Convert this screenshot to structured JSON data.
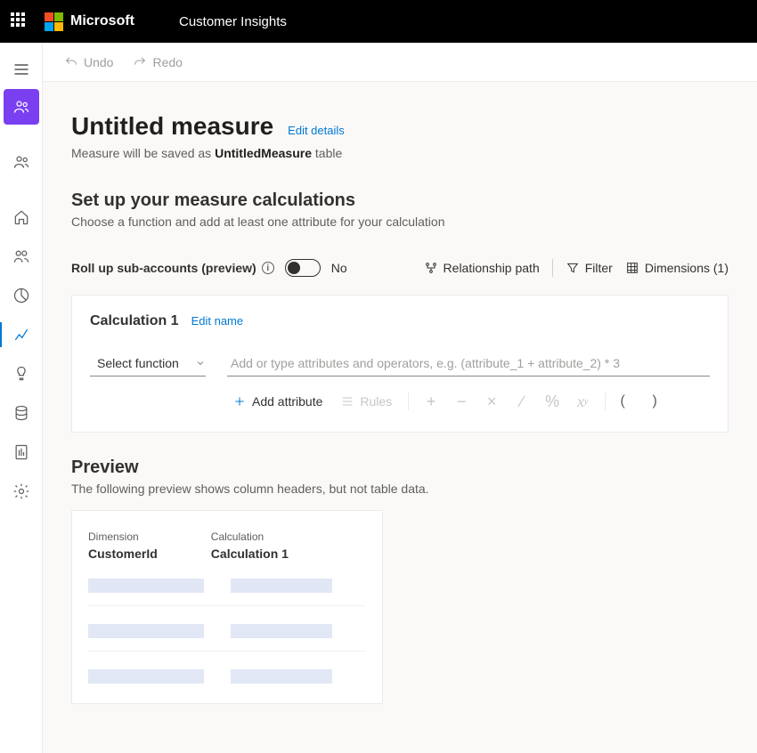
{
  "header": {
    "brand": "Microsoft",
    "product": "Customer Insights"
  },
  "commands": {
    "undo": "Undo",
    "redo": "Redo"
  },
  "page": {
    "title": "Untitled measure",
    "edit_details": "Edit details",
    "save_prefix": "Measure will be saved as ",
    "save_name": "UntitledMeasure",
    "save_suffix": " table"
  },
  "section": {
    "title": "Set up your measure calculations",
    "desc": "Choose a function and add at least one attribute for your calculation"
  },
  "rollup": {
    "label": "Roll up sub-accounts (preview)",
    "state": "No"
  },
  "tools": {
    "relationship": "Relationship path",
    "filter": "Filter",
    "dimensions": "Dimensions (1)"
  },
  "calc": {
    "title": "Calculation 1",
    "edit_name": "Edit name",
    "select_fn": "Select function",
    "formula_placeholder": "Add or type attributes and operators, e.g. (attribute_1 + attribute_2) * 3",
    "add_attribute": "Add attribute",
    "rules": "Rules"
  },
  "preview": {
    "title": "Preview",
    "desc": "The following preview shows column headers, but not table data.",
    "col1_label": "Dimension",
    "col1_value": "CustomerId",
    "col2_label": "Calculation",
    "col2_value": "Calculation 1"
  }
}
